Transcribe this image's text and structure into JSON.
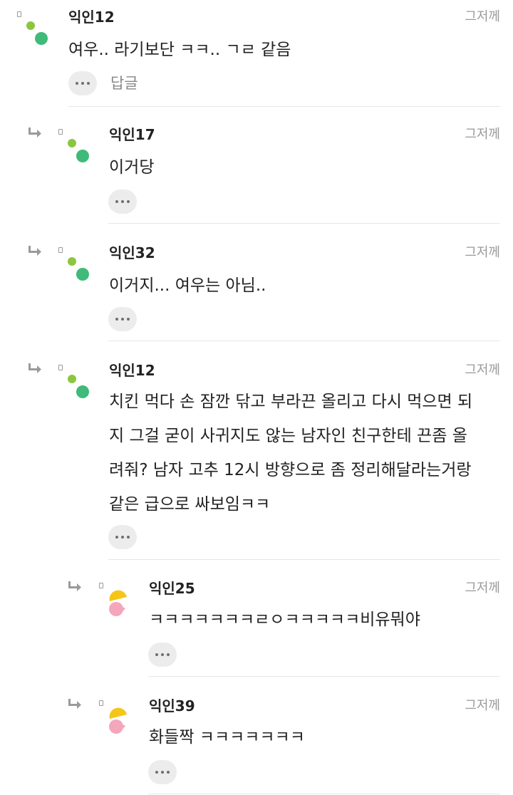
{
  "comments": [
    {
      "author": "익인12",
      "time": "그저께",
      "text": "여우.. 라기보단 ㅋㅋ.. ㄱㄹ 같음",
      "reply_label": "답글",
      "avatar": "green-dots"
    },
    {
      "author": "익인17",
      "time": "그저께",
      "text": "이거당",
      "avatar": "green-dots"
    },
    {
      "author": "익인32",
      "time": "그저께",
      "text": "이거지... 여우는 아님..",
      "avatar": "green-dots"
    },
    {
      "author": "익인12",
      "time": "그저께",
      "lines": [
        "치킨 먹다 손 잠깐 닦고 부라끈 올리고 다시 먹으면 되",
        "지 그걸 굳이 사귀지도 않는 남자인 친구한테 끈좀 올",
        "려줘? 남자 고추 12시 방향으로 좀 정리해달라는거랑",
        "같은 급으로 싸보임ㅋㅋ"
      ],
      "avatar": "green-dots"
    },
    {
      "author": "익인25",
      "time": "그저께",
      "text": "ㅋㅋㅋㅋㅋㅋㅋㄹㅇㅋㅋㅋㅋㅋ비유뭐야",
      "avatar": "yellow-pink-circles"
    },
    {
      "author": "익인39",
      "time": "그저께",
      "text": "화들짝 ㅋㅋㅋㅋㅋㅋㅋ",
      "avatar": "yellow-pink-circles"
    }
  ],
  "icons": {
    "more": "more-dots-icon",
    "reply": "reply-arrow-icon"
  },
  "colors": {
    "avatar_green_light": "#8cc63f",
    "avatar_green_dark": "#3fba78",
    "avatar_yellow": "#f5c518",
    "avatar_pink": "#f4a7bb",
    "text": "#222222",
    "muted": "#9a9a9a"
  }
}
